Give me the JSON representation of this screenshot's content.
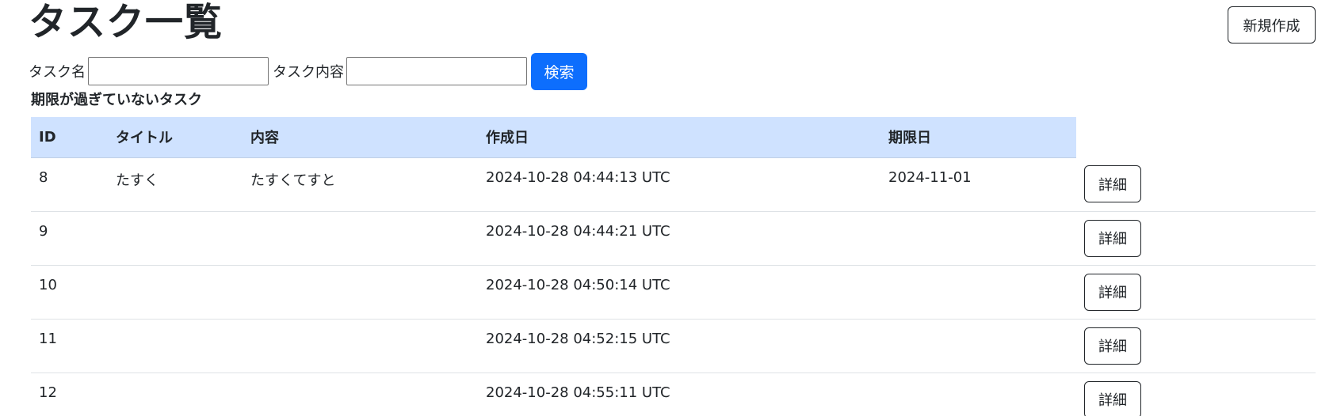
{
  "page": {
    "title": "タスク一覧",
    "new_button": "新規作成",
    "subtitle": "期限が過ぎていないタスク"
  },
  "search": {
    "name_label": "タスク名",
    "name_value": "",
    "content_label": "タスク内容",
    "content_value": "",
    "button": "検索"
  },
  "table": {
    "headers": [
      "ID",
      "タイトル",
      "内容",
      "作成日",
      "期限日"
    ],
    "rows": [
      {
        "id": "8",
        "title": "たすく",
        "content": "たすくてすと",
        "created": "2024-10-28 04:44:13 UTC",
        "due": "2024-11-01",
        "action": "詳細"
      },
      {
        "id": "9",
        "title": "",
        "content": "",
        "created": "2024-10-28 04:44:21 UTC",
        "due": "",
        "action": "詳細"
      },
      {
        "id": "10",
        "title": "",
        "content": "",
        "created": "2024-10-28 04:50:14 UTC",
        "due": "",
        "action": "詳細"
      },
      {
        "id": "11",
        "title": "",
        "content": "",
        "created": "2024-10-28 04:52:15 UTC",
        "due": "",
        "action": "詳細"
      },
      {
        "id": "12",
        "title": "",
        "content": "",
        "created": "2024-10-28 04:55:11 UTC",
        "due": "",
        "action": "詳細"
      }
    ]
  }
}
